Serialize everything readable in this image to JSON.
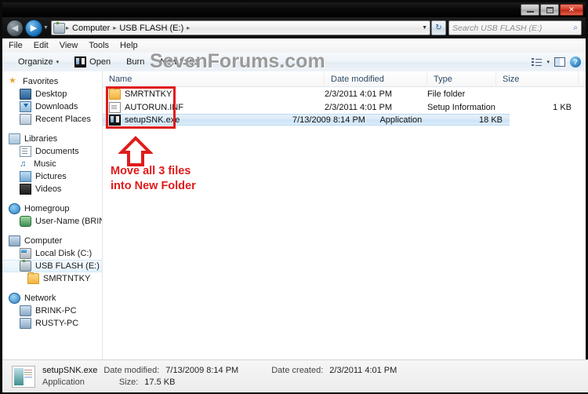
{
  "window": {
    "minimize_label": "Minimize",
    "maximize_label": "Maximize",
    "close_label": "✕"
  },
  "address_bar": {
    "back_label": "◀",
    "forward_label": "▶",
    "history_caret": "▼",
    "crumbs": [
      "Computer",
      "USB FLASH (E:)"
    ],
    "separator": "▸",
    "dropdown_caret": "▼",
    "refresh_label": "↻"
  },
  "search": {
    "placeholder": "Search USB FLASH (E:)",
    "icon": "⌕"
  },
  "menubar": {
    "items": [
      "File",
      "Edit",
      "View",
      "Tools",
      "Help"
    ]
  },
  "toolbar": {
    "organize_label": "Organize",
    "organize_caret": "▾",
    "open_label": "Open",
    "burn_label": "Burn",
    "new_folder_label": "New folder",
    "views_caret": "▾",
    "help_label": "?"
  },
  "watermark": "SevenForums.com",
  "sidebar": {
    "groups": [
      {
        "header": {
          "label": "Favorites",
          "icon": "star-icon"
        },
        "items": [
          {
            "label": "Desktop",
            "icon": "desktop-icon"
          },
          {
            "label": "Downloads",
            "icon": "downloads-icon"
          },
          {
            "label": "Recent Places",
            "icon": "recent-places-icon"
          }
        ]
      },
      {
        "header": {
          "label": "Libraries",
          "icon": "library-icon"
        },
        "items": [
          {
            "label": "Documents",
            "icon": "document-icon"
          },
          {
            "label": "Music",
            "icon": "music-icon"
          },
          {
            "label": "Pictures",
            "icon": "pictures-icon"
          },
          {
            "label": "Videos",
            "icon": "video-icon"
          }
        ]
      },
      {
        "header": {
          "label": "Homegroup",
          "icon": "homegroup-icon"
        },
        "items": [
          {
            "label": "User-Name (BRINK-",
            "icon": "user-icon"
          }
        ]
      },
      {
        "header": {
          "label": "Computer",
          "icon": "computer-icon"
        },
        "items": [
          {
            "label": "Local Disk (C:)",
            "icon": "harddisk-icon"
          },
          {
            "label": "USB FLASH (E:)",
            "icon": "usb-drive-icon",
            "selected": true
          },
          {
            "label": "SMRTNTKY",
            "icon": "folder-icon",
            "nested": true
          }
        ]
      },
      {
        "header": {
          "label": "Network",
          "icon": "network-icon"
        },
        "items": [
          {
            "label": "BRINK-PC",
            "icon": "computer-icon"
          },
          {
            "label": "RUSTY-PC",
            "icon": "computer-icon"
          }
        ]
      }
    ]
  },
  "file_list": {
    "columns": [
      "Name",
      "Date modified",
      "Type",
      "Size"
    ],
    "rows": [
      {
        "name": "SMRTNTKY",
        "date_modified": "2/3/2011 4:01 PM",
        "type": "File folder",
        "size": "",
        "icon": "folder-icon",
        "selected": false
      },
      {
        "name": "AUTORUN.INF",
        "date_modified": "2/3/2011 4:01 PM",
        "type": "Setup Information",
        "size": "1 KB",
        "icon": "inf-file-icon",
        "selected": false
      },
      {
        "name": "setupSNK.exe",
        "date_modified": "7/13/2009 8:14 PM",
        "type": "Application",
        "size": "18 KB",
        "icon": "exe-file-icon",
        "selected": true
      }
    ]
  },
  "annotation": {
    "line1": "Move all 3 files",
    "line2": "into New Folder",
    "color": "#e01b1b"
  },
  "status_bar": {
    "file_name": "setupSNK.exe",
    "file_type": "Application",
    "date_modified_label": "Date modified:",
    "date_modified_value": "7/13/2009 8:14 PM",
    "date_created_label": "Date created:",
    "date_created_value": "2/3/2011 4:01 PM",
    "size_label": "Size:",
    "size_value": "17.5 KB"
  }
}
